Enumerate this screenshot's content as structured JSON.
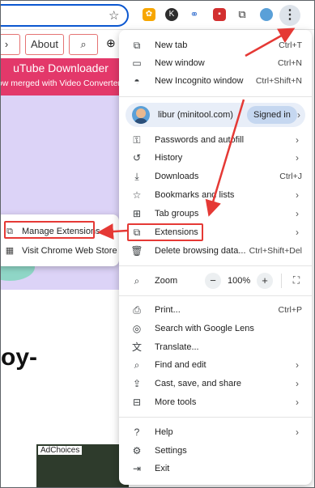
{
  "toolbar": {
    "menu_button_label": "⋮"
  },
  "page": {
    "nav": {
      "about_label": "About"
    },
    "banner": {
      "title": "uTube Downloader",
      "subtitle": "ow merged with Video Converter"
    },
    "big_text": "oy-",
    "ad_choices": "AdChoices"
  },
  "submenu": {
    "items": [
      {
        "label": "Manage Extensions"
      },
      {
        "label": "Visit Chrome Web Store"
      }
    ]
  },
  "menu": {
    "new_tab": {
      "label": "New tab",
      "shortcut": "Ctrl+T"
    },
    "new_window": {
      "label": "New window",
      "shortcut": "Ctrl+N"
    },
    "new_incognito": {
      "label": "New Incognito window",
      "shortcut": "Ctrl+Shift+N"
    },
    "profile": {
      "name": "libur (minitool.com)",
      "status": "Signed in"
    },
    "passwords": {
      "label": "Passwords and autofill"
    },
    "history": {
      "label": "History"
    },
    "downloads": {
      "label": "Downloads",
      "shortcut": "Ctrl+J"
    },
    "bookmarks": {
      "label": "Bookmarks and lists"
    },
    "tab_groups": {
      "label": "Tab groups"
    },
    "extensions": {
      "label": "Extensions"
    },
    "delete_data": {
      "label": "Delete browsing data...",
      "shortcut": "Ctrl+Shift+Del"
    },
    "zoom": {
      "label": "Zoom",
      "value": "100%",
      "minus": "−",
      "plus": "+"
    },
    "print": {
      "label": "Print...",
      "shortcut": "Ctrl+P"
    },
    "lens": {
      "label": "Search with Google Lens"
    },
    "translate": {
      "label": "Translate..."
    },
    "find_edit": {
      "label": "Find and edit"
    },
    "cast": {
      "label": "Cast, save, and share"
    },
    "more_tools": {
      "label": "More tools"
    },
    "help": {
      "label": "Help"
    },
    "settings": {
      "label": "Settings"
    },
    "exit": {
      "label": "Exit"
    }
  },
  "colors": {
    "accent": "#0b57d0",
    "highlight": "#e53935",
    "banner": "#e3386a",
    "lavender": "#dcd3f7"
  }
}
